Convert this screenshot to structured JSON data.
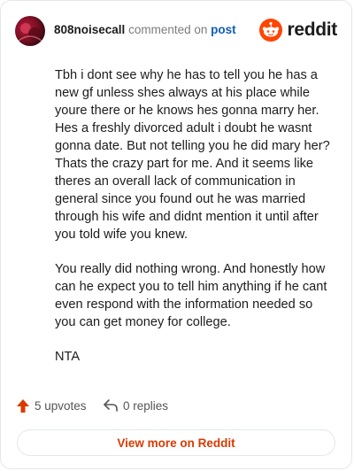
{
  "header": {
    "username": "808noisecall",
    "action_text": "commented on",
    "post_link": "post",
    "brand": "reddit",
    "avatar_icon": "avatar-icon",
    "brand_color": "#ff4500"
  },
  "comment": {
    "paragraphs": [
      "Tbh i dont see why he has to tell you he has a new gf unless shes always at his place while youre there or he knows hes gonna marry her. Hes a freshly divorced adult i doubt he wasnt gonna date. But not telling you he did mary her? Thats the crazy part for me. And it seems like theres an overall lack of communication in general since you found out he was married through his wife and didnt mention it until after you told wife you knew.",
      "You really did nothing wrong. And honestly how can he expect you to tell him anything if he cant even respond with the information needed so you can get money for college.",
      "NTA"
    ]
  },
  "footer": {
    "upvotes": "5 upvotes",
    "replies": "0 replies",
    "upvote_icon": "arrow-up-icon",
    "reply_icon": "reply-arrow-icon",
    "upvote_color": "#d93a00"
  },
  "cta": {
    "label": "View more on Reddit",
    "color": "#d93a00"
  }
}
